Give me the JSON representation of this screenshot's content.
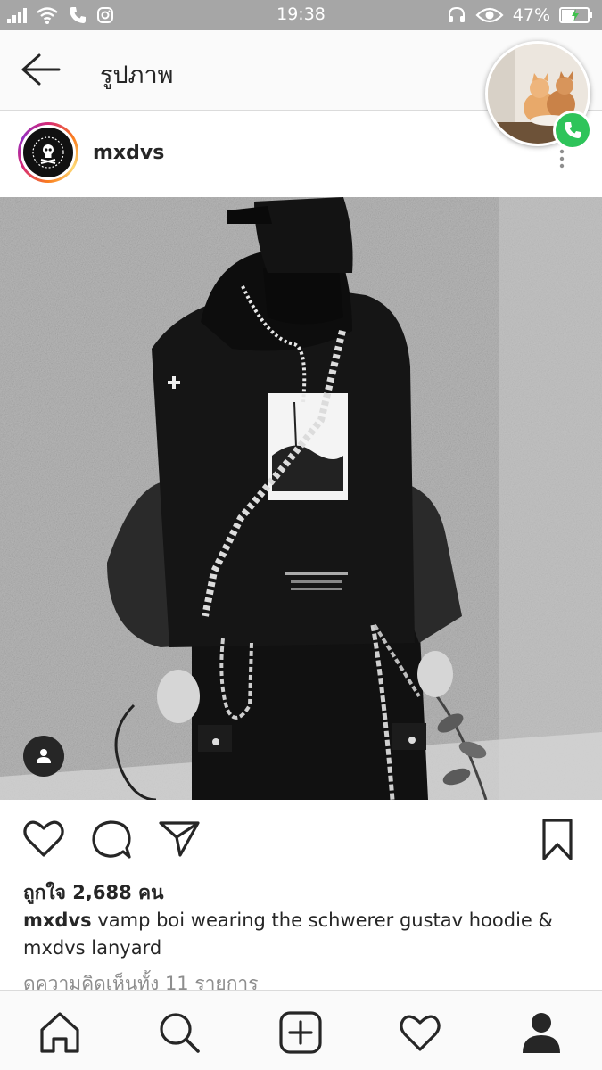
{
  "status_bar": {
    "time": "19:38",
    "battery": "47%"
  },
  "app_bar": {
    "title": "รูปภาพ"
  },
  "post": {
    "username": "mxdvs",
    "likes": "ถูกใจ 2,688 คน",
    "caption_user": "mxdvs",
    "caption_text": " vamp boi wearing the schwerer gustav hoodie & mxdvs lanyard",
    "comments_link": "ดูความคิดเห็นทั้ง 11 รายการ"
  },
  "icons": {
    "back": "back-arrow-icon",
    "like": "heart-icon",
    "comment": "comment-icon",
    "share": "send-icon",
    "save": "bookmark-icon",
    "home": "home-icon",
    "search": "search-icon",
    "add": "add-post-icon",
    "activity": "heart-icon",
    "profile": "profile-icon"
  },
  "colors": {
    "call_button": "#2ec45a",
    "status_bar": "#a6a6a6",
    "text": "#262626",
    "muted": "#8e8e8e"
  }
}
